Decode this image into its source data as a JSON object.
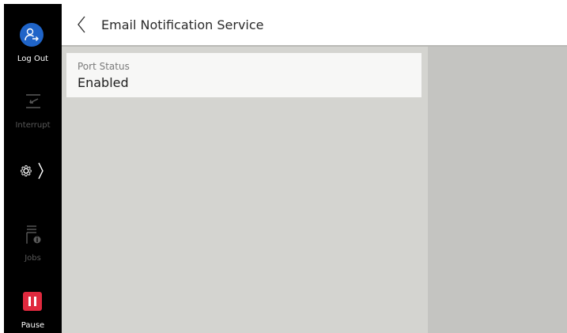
{
  "header": {
    "title": "Email Notification Service"
  },
  "sidebar": {
    "items": [
      {
        "label": "Log Out",
        "icon": "user-logout-icon",
        "color": "#1f64c8"
      },
      {
        "label": "Interrupt",
        "icon": "interrupt-icon",
        "enabled": false
      },
      {
        "label": "",
        "icon": "gear-icon",
        "selected": true
      },
      {
        "label": "Jobs",
        "icon": "jobs-icon",
        "enabled": false
      },
      {
        "label": "Pause",
        "icon": "pause-icon",
        "color": "#e0293e"
      }
    ]
  },
  "content": {
    "settings": [
      {
        "label": "Port Status",
        "value": "Enabled"
      }
    ]
  }
}
